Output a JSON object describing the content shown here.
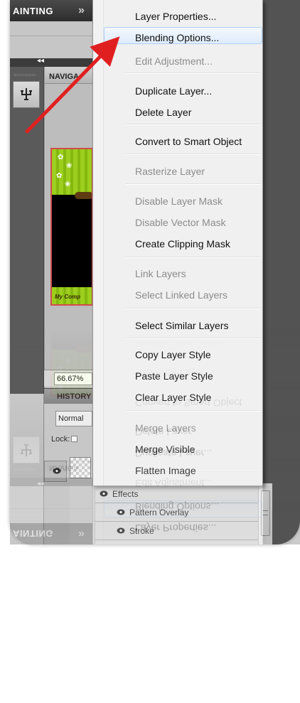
{
  "panel": {
    "title": "AINTING",
    "nav_header": "NAVIGA",
    "zoom_value": "66.67%",
    "history_header": "HISTORY",
    "blend_mode": "Normal",
    "lock_label": "Lock:",
    "thumb_brand": "My Comp"
  },
  "context_menu": {
    "items": [
      {
        "label": "Layer Properties...",
        "enabled": true
      },
      {
        "label": "Blending Options...",
        "enabled": true,
        "highlighted": true
      },
      {
        "label": "Edit Adjustment...",
        "enabled": false
      },
      {
        "label": "Duplicate Layer...",
        "enabled": true
      },
      {
        "label": "Delete Layer",
        "enabled": true
      },
      {
        "label": "Convert to Smart Object",
        "enabled": true
      },
      {
        "label": "Rasterize Layer",
        "enabled": false
      },
      {
        "label": "Disable Layer Mask",
        "enabled": false
      },
      {
        "label": "Disable Vector Mask",
        "enabled": false
      },
      {
        "label": "Create Clipping Mask",
        "enabled": true
      },
      {
        "label": "Link Layers",
        "enabled": false
      },
      {
        "label": "Select Linked Layers",
        "enabled": false
      },
      {
        "label": "Select Similar Layers",
        "enabled": true
      },
      {
        "label": "Copy Layer Style",
        "enabled": true
      },
      {
        "label": "Paste Layer Style",
        "enabled": true
      },
      {
        "label": "Clear Layer Style",
        "enabled": true
      },
      {
        "label": "Merge Layers",
        "enabled": false
      },
      {
        "label": "Merge Visible",
        "enabled": true
      },
      {
        "label": "Flatten Image",
        "enabled": true
      }
    ]
  },
  "effects": {
    "group": "Effects",
    "items": [
      "Pattern Overlay",
      "Stroke"
    ]
  },
  "colors": {
    "arrow": "#e02020",
    "highlight": "#dfecfb",
    "selection": "#3d8ee6"
  },
  "icons": [
    "double-chevron-icon",
    "collapse-icon",
    "tool-icon",
    "eye-icon",
    "scroll-grip-icon"
  ]
}
